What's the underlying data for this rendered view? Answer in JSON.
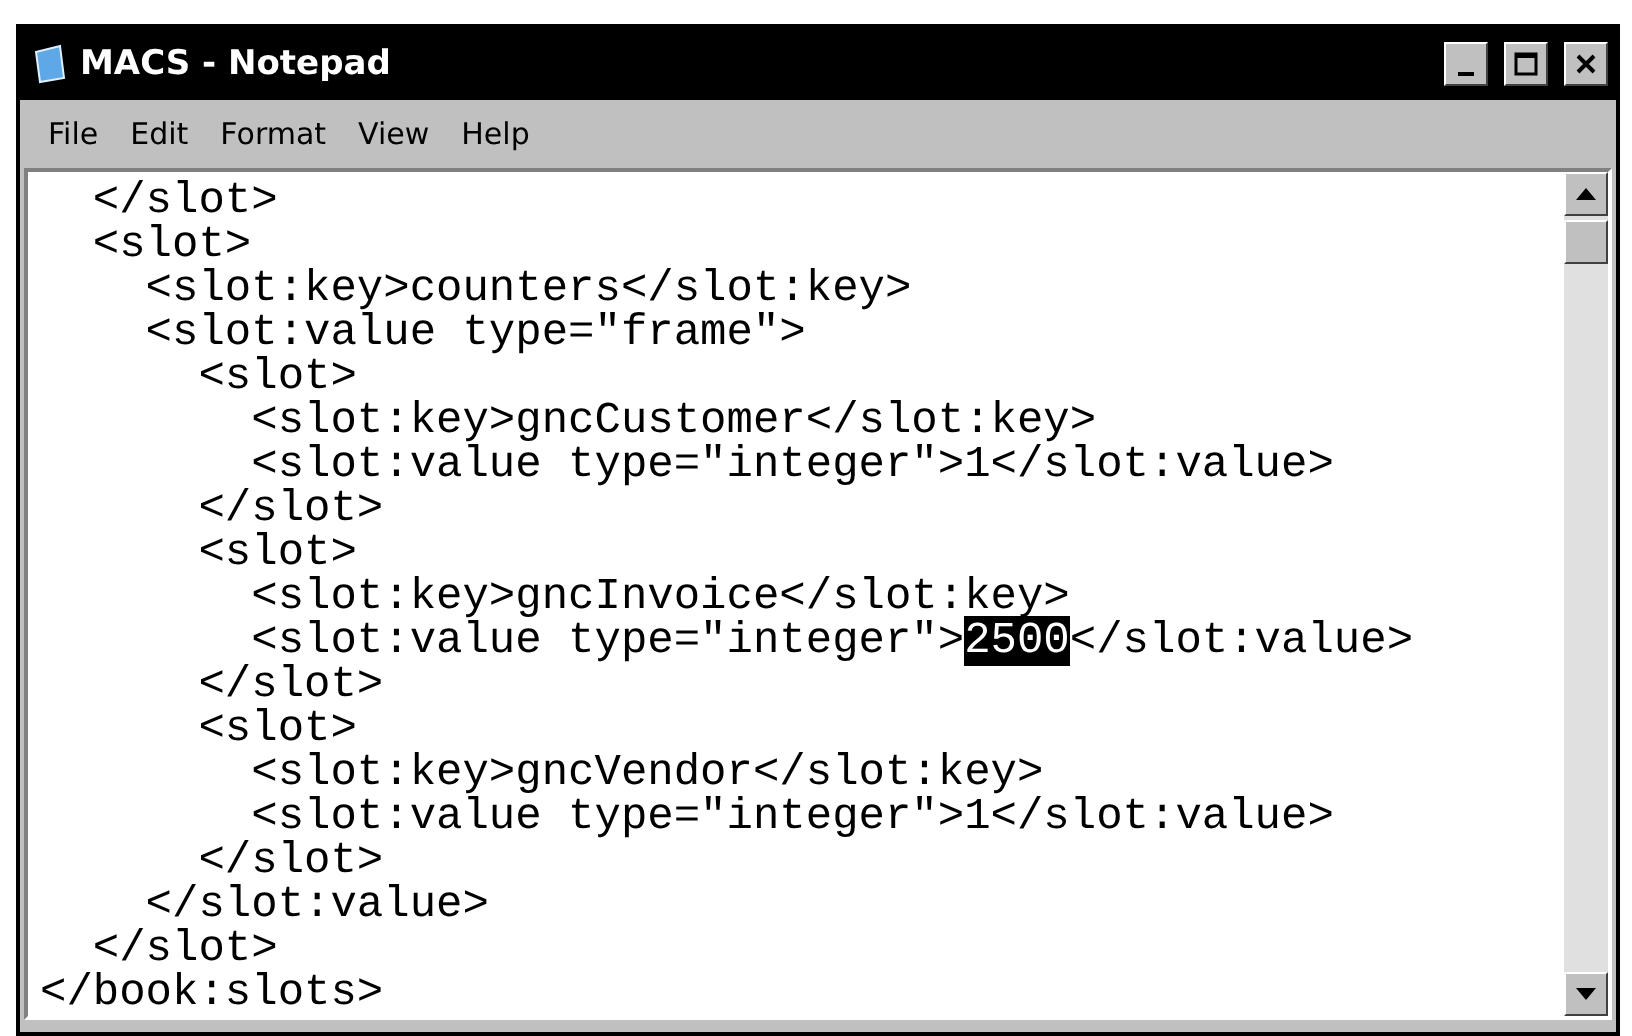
{
  "window": {
    "title": "MACS - Notepad",
    "controls": [
      {
        "kind": "minimize"
      },
      {
        "kind": "maximize"
      },
      {
        "kind": "close"
      }
    ]
  },
  "menu": [
    "File",
    "Edit",
    "Format",
    "View",
    "Help"
  ],
  "editor": {
    "lines": [
      [
        {
          "text": "  </slot>",
          "selected": false
        }
      ],
      [
        {
          "text": "  <slot>",
          "selected": false
        }
      ],
      [
        {
          "text": "    <slot:key>counters</slot:key>",
          "selected": false
        }
      ],
      [
        {
          "text": "    <slot:value type=\"frame\">",
          "selected": false
        }
      ],
      [
        {
          "text": "      <slot>",
          "selected": false
        }
      ],
      [
        {
          "text": "        <slot:key>gncCustomer</slot:key>",
          "selected": false
        }
      ],
      [
        {
          "text": "        <slot:value type=\"integer\">1</slot:value>",
          "selected": false
        }
      ],
      [
        {
          "text": "      </slot>",
          "selected": false
        }
      ],
      [
        {
          "text": "      <slot>",
          "selected": false
        }
      ],
      [
        {
          "text": "        <slot:key>gncInvoice</slot:key>",
          "selected": false
        }
      ],
      [
        {
          "text": "        <slot:value type=\"integer\">",
          "selected": false
        },
        {
          "text": "2500",
          "selected": true
        },
        {
          "text": "</slot:value>",
          "selected": false
        }
      ],
      [
        {
          "text": "      </slot>",
          "selected": false
        }
      ],
      [
        {
          "text": "      <slot>",
          "selected": false
        }
      ],
      [
        {
          "text": "        <slot:key>gncVendor</slot:key>",
          "selected": false
        }
      ],
      [
        {
          "text": "        <slot:value type=\"integer\">1</slot:value>",
          "selected": false
        }
      ],
      [
        {
          "text": "      </slot>",
          "selected": false
        }
      ],
      [
        {
          "text": "    </slot:value>",
          "selected": false
        }
      ],
      [
        {
          "text": "  </slot>",
          "selected": false
        }
      ],
      [
        {
          "text": "</book:slots>",
          "selected": false
        }
      ]
    ]
  }
}
